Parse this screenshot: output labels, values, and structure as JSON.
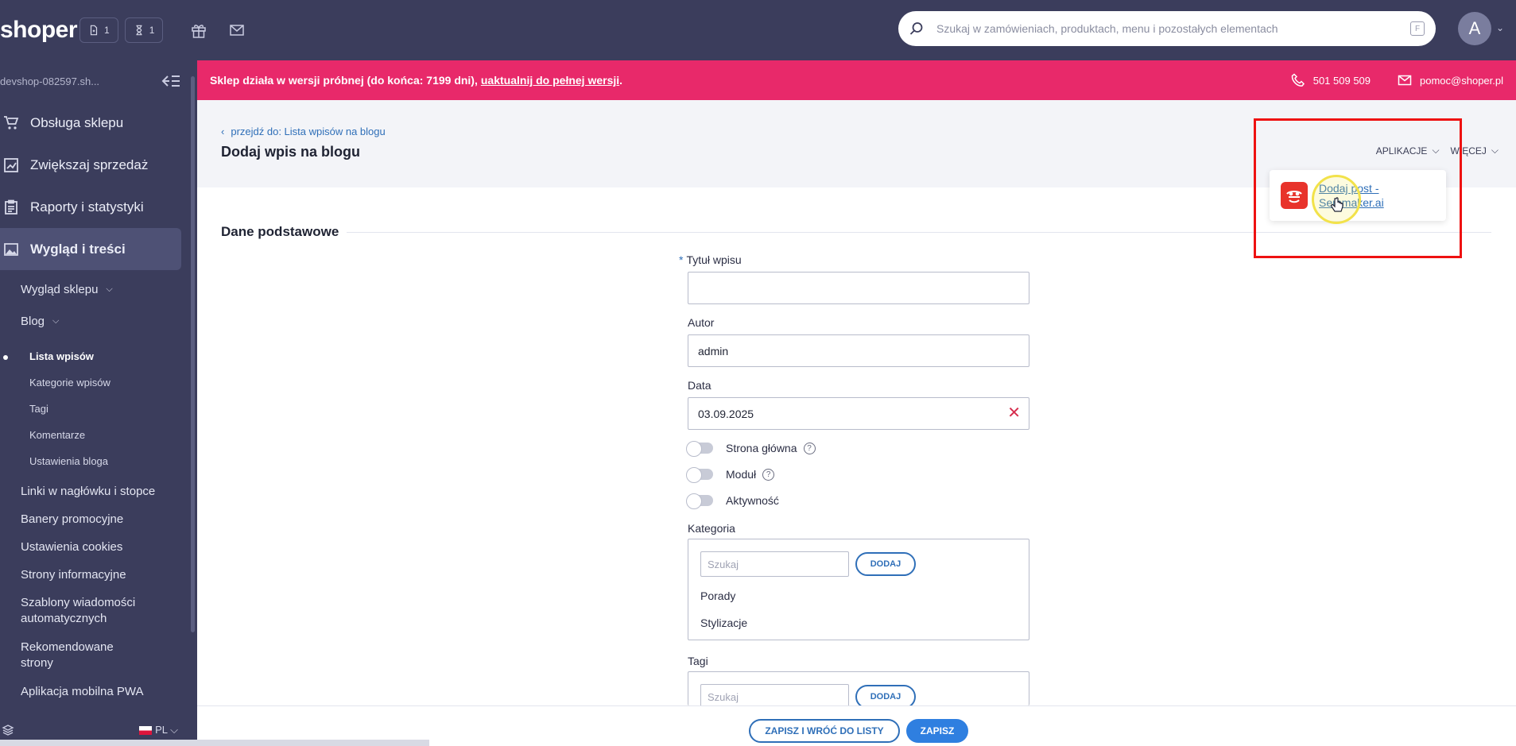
{
  "topbar": {
    "logo": "shoper",
    "counter_orders": "1",
    "counter_pending": "1",
    "search_placeholder": "Szukaj w zamówieniach, produktach, menu i pozostałych elementach",
    "search_shortcut": "F",
    "avatar_letter": "A"
  },
  "sidebar": {
    "shop_name": "devshop-082597.sh...",
    "main_items": [
      "Obsługa sklepu",
      "Zwiększaj sprzedaż",
      "Raporty i statystyki",
      "Wygląd i treści"
    ],
    "sub_wyglad": "Wygląd sklepu",
    "sub_blog": "Blog",
    "blog_items": [
      "Lista wpisów",
      "Kategorie wpisów",
      "Tagi",
      "Komentarze",
      "Ustawienia bloga"
    ],
    "other_items": [
      "Linki w nagłówku i stopce",
      "Banery promocyjne",
      "Ustawienia cookies",
      "Strony informacyjne",
      "Szablony wiadomości automatycznych",
      "Rekomendowane strony",
      "Aplikacja mobilna PWA"
    ],
    "language": "PL"
  },
  "banner": {
    "text": "Sklep działa w wersji próbnej (do końca: 7199 dni),",
    "link": "uaktualnij do pełnej wersji",
    "suffix": ".",
    "phone": "501 509 509",
    "email": "pomoc@shoper.pl"
  },
  "header": {
    "breadcrumb": "przejdź do: Lista wpisów na blogu",
    "title": "Dodaj wpis na blogu",
    "apps_label": "APLIKACJE",
    "more_label": "WIĘCEJ",
    "dropdown_item": "Dodaj post - Semmaker.ai"
  },
  "form": {
    "section_title": "Dane podstawowe",
    "title_label": "Tytuł wpisu",
    "title_value": "",
    "author_label": "Autor",
    "author_value": "admin",
    "date_label": "Data",
    "date_value": "03.09.2025",
    "toggles": [
      "Strona główna",
      "Moduł",
      "Aktywność"
    ],
    "category_label": "Kategoria",
    "search_placeholder": "Szukaj",
    "add_label": "DODAJ",
    "categories": [
      "Porady",
      "Stylizacje"
    ],
    "tags_label": "Tagi"
  },
  "footer": {
    "save_back": "ZAPISZ I WRÓĆ DO LISTY",
    "save": "ZAPISZ"
  },
  "colors": {
    "sidebar_bg": "#3b3d5c",
    "banner_bg": "#e8296a",
    "accent": "#2f6fb8",
    "highlight": "#ee1111"
  }
}
